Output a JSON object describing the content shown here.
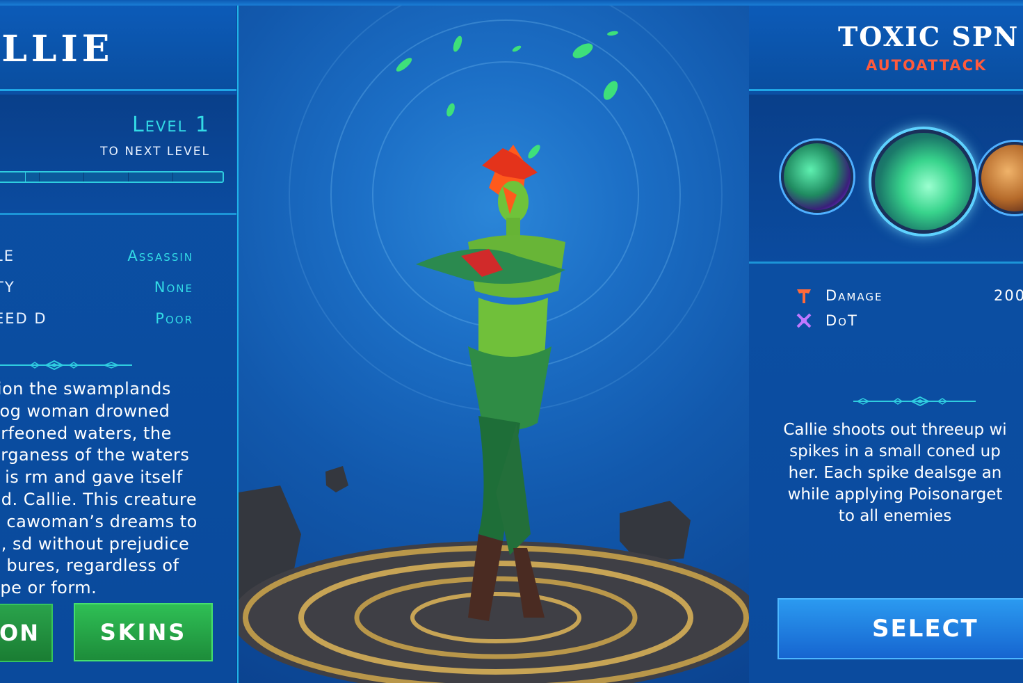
{
  "hero": {
    "name": "ILLIE",
    "level": "Level 1",
    "next_level": "TO NEXT LEVEL",
    "xp_progress": 0.0,
    "stats": [
      {
        "key": "LE",
        "value": "Assassin"
      },
      {
        "key": "TY",
        "value": "None"
      },
      {
        "key": "EED D",
        "value": "Poor"
      }
    ],
    "lore_lines": [
      "tion the swamplands",
      " Fog woman drowned",
      "erfeoned waters, the",
      "erganess of the waters",
      "s is rm and gave itself",
      "nd. Callie. This creature",
      "e cawoman’s dreams to",
      "g, sd without prejudice",
      "o bures, regardless of",
      "kpe or form."
    ]
  },
  "buttons": {
    "left_partial": "ON",
    "skins": "SKINS",
    "select": "SELECT"
  },
  "ability": {
    "title": "TOXIC SPN",
    "type": "AUTOATTACK",
    "attributes": [
      {
        "icon": "damage-icon",
        "label": "Damage",
        "value": "200"
      },
      {
        "icon": "dot-icon",
        "label": "DoT",
        "value": ""
      }
    ],
    "description_lines": [
      "Callie shoots out threeup wi",
      "spikes in a small coned up",
      "her. Each spike dealsge an",
      "while applying Poisonarget",
      "to all enemies"
    ]
  },
  "colors": {
    "accent_cyan": "#33dbe6",
    "ability_type_red": "#ff5a3c",
    "skins_green": "#2fbf55",
    "select_blue": "#1f7fe0"
  }
}
